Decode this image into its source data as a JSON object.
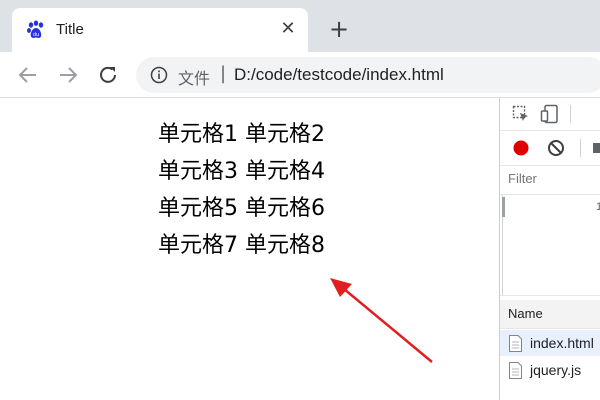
{
  "browser": {
    "tab": {
      "title": "Title",
      "favicon": "baidu-paw-icon",
      "close_symbol": "✕"
    },
    "new_tab_symbol": "+",
    "omnibox": {
      "security_label": "文件",
      "separator": "|",
      "url": "D:/code/testcode/index.html"
    }
  },
  "page": {
    "rows": [
      [
        "单元格1",
        "单元格2"
      ],
      [
        "单元格3",
        "单元格4"
      ],
      [
        "单元格5",
        "单元格6"
      ],
      [
        "单元格7",
        "单元格8"
      ]
    ],
    "arrow_color": "#e02020"
  },
  "devtools": {
    "filter_placeholder": "Filter",
    "overview_tick": "1",
    "name_column": "Name",
    "files": [
      {
        "name": "index.html",
        "selected": true
      },
      {
        "name": "jquery.js",
        "selected": false
      }
    ],
    "record_color": "#e00000"
  }
}
